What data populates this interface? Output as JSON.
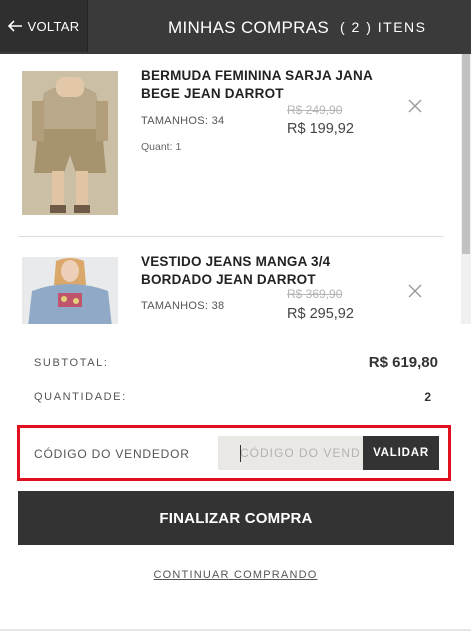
{
  "header": {
    "back_label": "VOLTAR",
    "title": "MINHAS COMPRAS",
    "count": "( 2 ) ITENS"
  },
  "products": [
    {
      "name": "BERMUDA FEMININA SARJA JANA BEGE JEAN DARROT",
      "size": "TAMANHOS: 34",
      "quantity": "Quant: 1",
      "old_price": "R$ 249,90",
      "new_price": "R$ 199,92"
    },
    {
      "name": "VESTIDO JEANS MANGA 3/4 BORDADO JEAN DARROT",
      "size": "TAMANHOS: 38",
      "old_price": "R$ 369,90",
      "new_price": "R$ 295,92"
    }
  ],
  "summary": {
    "subtotal_label": "SUBTOTAL:",
    "subtotal_value": "R$ 619,80",
    "quantity_label": "QUANTIDADE:",
    "quantity_value": "2"
  },
  "seller": {
    "label": "CÓDIGO DO VENDEDOR",
    "placeholder": "CÓDIGO DO VEND",
    "value": "",
    "button_label": "VALIDAR"
  },
  "finalize_label": "FINALIZAR COMPRA",
  "continue_label": "CONTINUAR COMPRANDO",
  "colors": {
    "header_bg": "#3a3a3a",
    "button_bg": "#333333",
    "highlight_border": "#e0101e",
    "input_bg": "#eae8e5"
  }
}
